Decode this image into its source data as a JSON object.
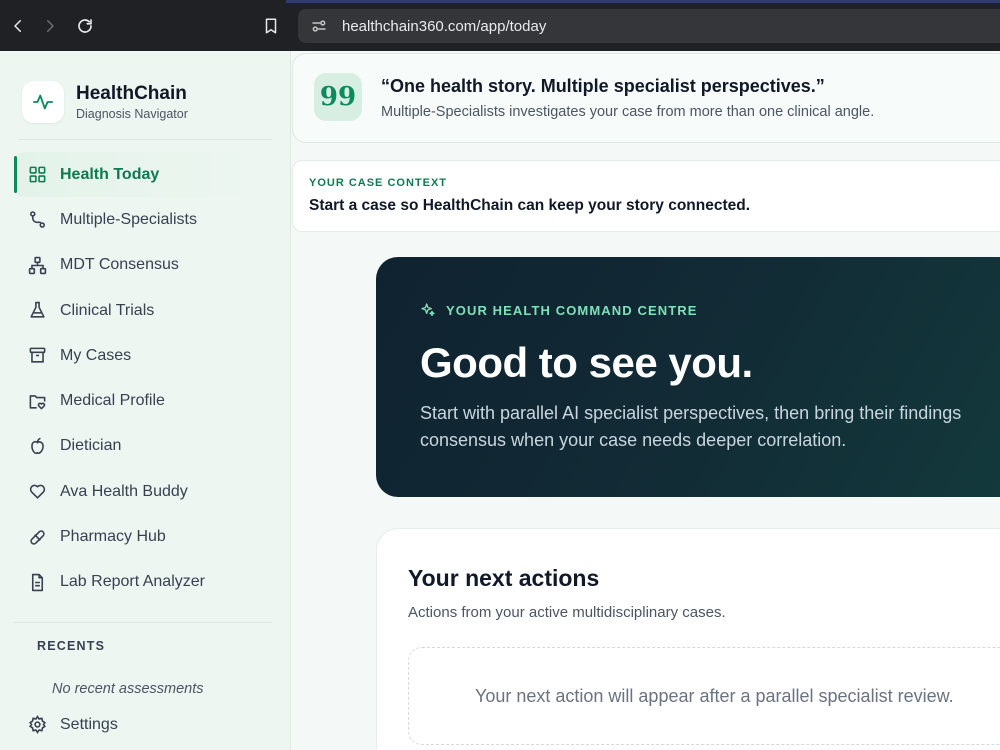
{
  "browser": {
    "url": "healthchain360.com/app/today",
    "icons": [
      "back-icon",
      "forward-icon",
      "reload-icon",
      "bookmark-icon",
      "site-settings-icon"
    ]
  },
  "brand": {
    "name": "HealthChain",
    "subtitle": "Diagnosis Navigator",
    "icon": "pulse-icon"
  },
  "sidebar": {
    "items": [
      {
        "label": "Health Today",
        "icon": "dashboard-icon",
        "active": true
      },
      {
        "label": "Multiple-Specialists",
        "icon": "route-icon",
        "active": false
      },
      {
        "label": "MDT Consensus",
        "icon": "network-icon",
        "active": false
      },
      {
        "label": "Clinical Trials",
        "icon": "flask-icon",
        "active": false
      },
      {
        "label": "My Cases",
        "icon": "archive-icon",
        "active": false
      },
      {
        "label": "Medical Profile",
        "icon": "folder-heart-icon",
        "active": false
      },
      {
        "label": "Dietician",
        "icon": "apple-icon",
        "active": false
      },
      {
        "label": "Ava Health Buddy",
        "icon": "heart-icon",
        "active": false
      },
      {
        "label": "Pharmacy Hub",
        "icon": "pill-icon",
        "active": false
      },
      {
        "label": "Lab Report Analyzer",
        "icon": "document-icon",
        "active": false
      }
    ],
    "recents_title": "RECENTS",
    "recents_empty": "No recent assessments",
    "settings_label": "Settings"
  },
  "quote": {
    "title": "“One health story. Multiple specialist perspectives.”",
    "subtitle": "Multiple-Specialists investigates your case from more than one clinical angle.",
    "icon_glyph": "99"
  },
  "context": {
    "label": "YOUR CASE CONTEXT",
    "text": "Start a case so HealthChain can keep your story connected."
  },
  "hero": {
    "kicker": "YOUR HEALTH COMMAND CENTRE",
    "title": "Good to see you.",
    "body": "Start with parallel AI specialist perspectives, then bring their findings consensus when your case needs deeper correlation."
  },
  "actions": {
    "title": "Your next actions",
    "subtitle": "Actions from your active multidisciplinary cases.",
    "empty": "Your next action will appear after a parallel specialist review."
  },
  "colors": {
    "accent": "#0f8a5f",
    "sidebar_bg": "#eef6f1",
    "hero_bg": "#0f2230",
    "kicker": "#7ee2b8"
  }
}
